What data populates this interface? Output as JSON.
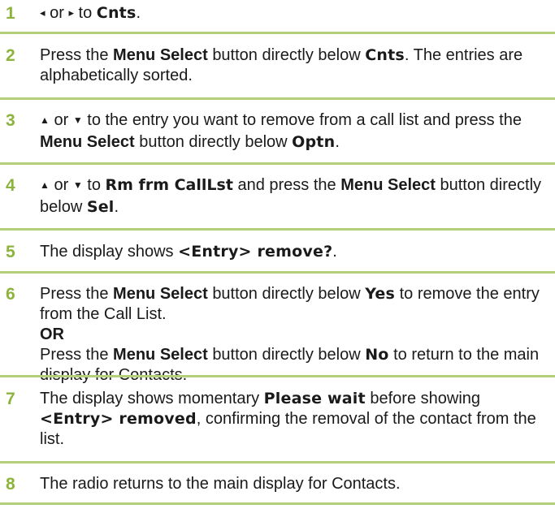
{
  "steps": [
    {
      "num": "1",
      "left_symbol": "◂",
      "or": "or",
      "right_symbol": "▸",
      "to": "to",
      "target": "Cnts",
      "end": "."
    },
    {
      "num": "2",
      "pre": "Press the",
      "button": "Menu Select",
      "mid": "button directly below",
      "target": "Cnts",
      "post": ". The entries are alphabetically sorted."
    },
    {
      "num": "3",
      "up_symbol": "▲",
      "or": "or",
      "down_symbol": "▼",
      "pre": "to the entry you want to remove from a call list and press the",
      "button": "Menu Select",
      "mid": "button directly below",
      "target": "Optn",
      "end": "."
    },
    {
      "num": "4",
      "up_symbol": "▲",
      "or": "or",
      "down_symbol": "▼",
      "to": "to",
      "target1": "Rm frm CallLst",
      "pre": "and press the",
      "button": "Menu Select",
      "mid": "button directly below",
      "target2": "Sel",
      "end": "."
    },
    {
      "num": "5",
      "pre": "The display shows",
      "target": "<Entry> remove?",
      "end": "."
    },
    {
      "num": "6",
      "pre1": "Press the",
      "button1": "Menu Select",
      "mid1": "button directly below",
      "target1": "Yes",
      "post1": "to remove the entry from the Call List.",
      "or": "OR",
      "pre2": "Press the",
      "button2": "Menu Select",
      "mid2": "button directly below",
      "target2": "No",
      "post2": "to return to the main display for Contacts."
    },
    {
      "num": "7",
      "pre": "The display shows momentary",
      "target1": "Please wait",
      "mid": "before showing",
      "target2": "<Entry> removed",
      "post": ", confirming the removal of the contact from the list."
    },
    {
      "num": "8",
      "text": "The radio returns to the main display for Contacts."
    }
  ]
}
